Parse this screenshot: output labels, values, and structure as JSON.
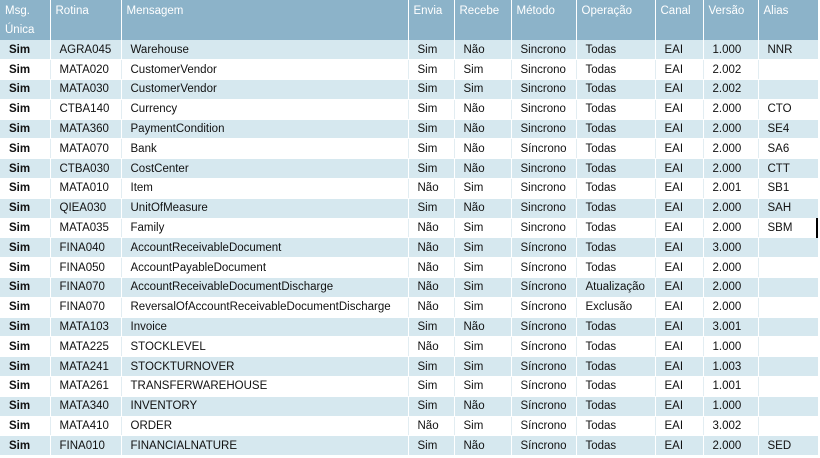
{
  "headers": [
    "Msg. Única",
    "Rotina",
    "Mensagem",
    "Envia",
    "Recebe",
    "Método",
    "Operação",
    "Canal",
    "Versão",
    "Alias"
  ],
  "rows": [
    [
      "Sim",
      "AGRA045",
      "Warehouse",
      "Sim",
      "Não",
      "Sincrono",
      "Todas",
      "EAI",
      "1.000",
      "NNR"
    ],
    [
      "Sim",
      "MATA020",
      "CustomerVendor",
      "Sim",
      "Sim",
      "Sincrono",
      "Todas",
      "EAI",
      "2.002",
      ""
    ],
    [
      "Sim",
      "MATA030",
      "CustomerVendor",
      "Sim",
      "Sim",
      "Sincrono",
      "Todas",
      "EAI",
      "2.002",
      ""
    ],
    [
      "Sim",
      "CTBA140",
      "Currency",
      "Sim",
      "Não",
      "Sincrono",
      "Todas",
      "EAI",
      "2.000",
      "CTO"
    ],
    [
      "Sim",
      "MATA360",
      "PaymentCondition",
      "Sim",
      "Não",
      "Sincrono",
      "Todas",
      "EAI",
      "2.000",
      "SE4"
    ],
    [
      "Sim",
      "MATA070",
      "Bank",
      "Sim",
      "Não",
      "Síncrono",
      "Todas",
      "EAI",
      "2.000",
      "SA6"
    ],
    [
      "Sim",
      "CTBA030",
      "CostCenter",
      "Sim",
      "Não",
      "Sincrono",
      "Todas",
      "EAI",
      "2.000",
      "CTT"
    ],
    [
      "Sim",
      "MATA010",
      "Item",
      "Não",
      "Sim",
      "Sincrono",
      "Todas",
      "EAI",
      "2.001",
      "SB1"
    ],
    [
      "Sim",
      "QIEA030",
      "UnitOfMeasure",
      "Sim",
      "Não",
      "Sincrono",
      "Todas",
      "EAI",
      "2.000",
      "SAH"
    ],
    [
      "Sim",
      "MATA035",
      "Family",
      "Não",
      "Sim",
      "Sincrono",
      "Todas",
      "EAI",
      "2.000",
      "SBM"
    ],
    [
      "Sim",
      "FINA040",
      "AccountReceivableDocument",
      "Não",
      "Sim",
      "Síncrono",
      "Todas",
      "EAI",
      "3.000",
      ""
    ],
    [
      "Sim",
      "FINA050",
      "AccountPayableDocument",
      "Não",
      "Sim",
      "Síncrono",
      "Todas",
      "EAI",
      "2.000",
      ""
    ],
    [
      "Sim",
      "FINA070",
      "AccountReceivableDocumentDischarge",
      "Não",
      "Sim",
      "Síncrono",
      "Atualização",
      "EAI",
      "2.000",
      ""
    ],
    [
      "Sim",
      "FINA070",
      "ReversalOfAccountReceivableDocumentDischarge",
      "Não",
      "Sim",
      "Síncrono",
      "Exclusão",
      "EAI",
      "2.000",
      ""
    ],
    [
      "Sim",
      "MATA103",
      "Invoice",
      "Sim",
      "Não",
      "Síncrono",
      "Todas",
      "EAI",
      "3.001",
      ""
    ],
    [
      "Sim",
      "MATA225",
      "STOCKLEVEL",
      "Não",
      "Sim",
      "Síncrono",
      "Todas",
      "EAI",
      "1.000",
      ""
    ],
    [
      "Sim",
      "MATA241",
      "STOCKTURNOVER",
      "Sim",
      "Sim",
      "Síncrono",
      "Todas",
      "EAI",
      "1.003",
      ""
    ],
    [
      "Sim",
      "MATA261",
      "TRANSFERWAREHOUSE",
      "Sim",
      "Sim",
      "Síncrono",
      "Todas",
      "EAI",
      "1.001",
      ""
    ],
    [
      "Sim",
      "MATA340",
      "INVENTORY",
      "Sim",
      "Não",
      "Síncrono",
      "Todas",
      "EAI",
      "1.000",
      ""
    ],
    [
      "Sim",
      "MATA410",
      "ORDER",
      "Não",
      "Sim",
      "Síncrono",
      "Todas",
      "EAI",
      "3.002",
      ""
    ],
    [
      "Sim",
      "FINA010",
      "FINANCIALNATURE",
      "Sim",
      "Não",
      "Síncrono",
      "Todas",
      "EAI",
      "2.000",
      "SED"
    ]
  ],
  "colors": {
    "header_bg": "#8cb3c9",
    "header_text": "#ffffff",
    "row_alt_bg": "#d6e8ef",
    "row_bg": "#ffffff"
  }
}
